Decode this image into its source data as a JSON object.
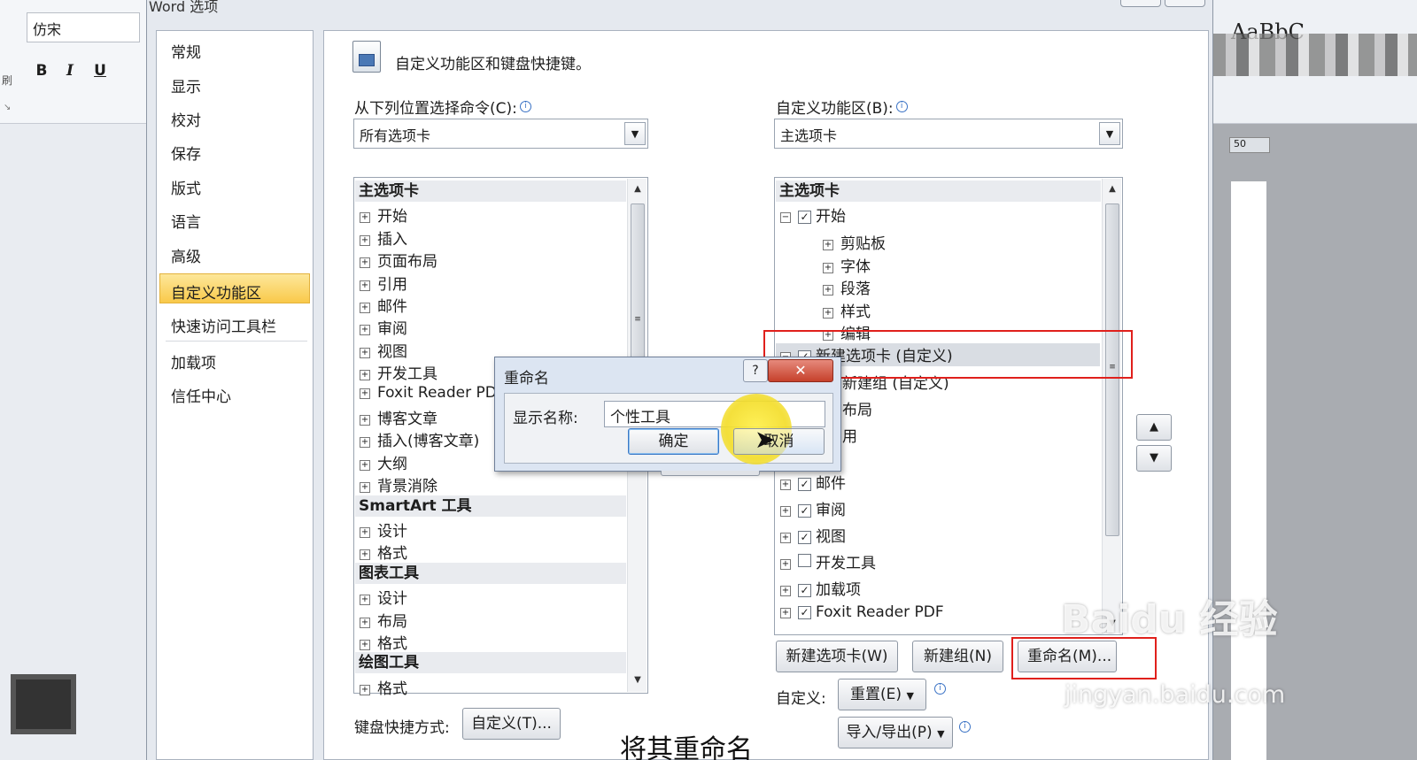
{
  "background": {
    "font_name": "仿宋",
    "format_buttons": [
      "B",
      "I",
      "U"
    ],
    "ruler_number": "50",
    "styles_preview": "AaBbC"
  },
  "dialog": {
    "title": "Word 选项",
    "nav": [
      "常规",
      "显示",
      "校对",
      "保存",
      "版式",
      "语言",
      "高级",
      "自定义功能区",
      "快速访问工具栏",
      "加载项",
      "信任中心"
    ],
    "selected_nav": "自定义功能区",
    "header_text": "自定义功能区和键盘快捷键。",
    "left": {
      "label": "从下列位置选择命令(C):",
      "combo_value": "所有选项卡",
      "items": [
        {
          "type": "group",
          "text": "主选项卡"
        },
        {
          "type": "item",
          "text": "开始"
        },
        {
          "type": "item",
          "text": "插入"
        },
        {
          "type": "item",
          "text": "页面布局"
        },
        {
          "type": "item",
          "text": "引用"
        },
        {
          "type": "item",
          "text": "邮件"
        },
        {
          "type": "item",
          "text": "审阅"
        },
        {
          "type": "item",
          "text": "视图"
        },
        {
          "type": "item",
          "text": "开发工具"
        },
        {
          "type": "item",
          "text": "Foxit Reader PD"
        },
        {
          "type": "item",
          "text": "博客文章"
        },
        {
          "type": "item",
          "text": "插入(博客文章)"
        },
        {
          "type": "item",
          "text": "大纲"
        },
        {
          "type": "item",
          "text": "背景消除"
        },
        {
          "type": "group",
          "text": "SmartArt 工具"
        },
        {
          "type": "item",
          "text": "设计"
        },
        {
          "type": "item",
          "text": "格式"
        },
        {
          "type": "group",
          "text": "图表工具"
        },
        {
          "type": "item",
          "text": "设计"
        },
        {
          "type": "item",
          "text": "布局"
        },
        {
          "type": "item",
          "text": "格式"
        },
        {
          "type": "group",
          "text": "绘图工具"
        },
        {
          "type": "item",
          "text": "格式"
        }
      ]
    },
    "right": {
      "label": "自定义功能区(B):",
      "combo_value": "主选项卡",
      "items": [
        {
          "type": "group",
          "text": "主选项卡"
        },
        {
          "type": "tab",
          "text": "开始",
          "checked": true,
          "expanded": true
        },
        {
          "type": "sub",
          "text": "剪贴板"
        },
        {
          "type": "sub",
          "text": "字体"
        },
        {
          "type": "sub",
          "text": "段落"
        },
        {
          "type": "sub",
          "text": "样式"
        },
        {
          "type": "sub",
          "text": "编辑"
        },
        {
          "type": "tab",
          "text": "新建选项卡 (自定义)",
          "checked": true,
          "expanded": true,
          "selected": true
        },
        {
          "type": "sub2",
          "text": "新建组 (自定义)"
        },
        {
          "type": "partial",
          "text": "布局"
        },
        {
          "type": "partial",
          "text": "用"
        },
        {
          "type": "tab",
          "text": "邮件",
          "checked": true
        },
        {
          "type": "tab",
          "text": "审阅",
          "checked": true
        },
        {
          "type": "tab",
          "text": "视图",
          "checked": true
        },
        {
          "type": "tab",
          "text": "开发工具",
          "checked": false
        },
        {
          "type": "tab",
          "text": "加载项",
          "checked": true
        },
        {
          "type": "tab",
          "text": "Foxit Reader PDF",
          "checked": true
        }
      ]
    },
    "buttons": {
      "new_tab": "新建选项卡(W)",
      "new_group": "新建组(N)",
      "rename": "重命名(M)...",
      "customize_label": "自定义:",
      "reset": "重置(E)",
      "import_export": "导入/导出(P)",
      "keyboard_label": "键盘快捷方式:",
      "keyboard_customize": "自定义(T)..."
    }
  },
  "rename_dialog": {
    "title": "重命名",
    "help": "?",
    "close": "✕",
    "name_label": "显示名称:",
    "name_value": "个性工具",
    "ok": "确定",
    "cancel": "取消"
  },
  "overlay": {
    "watermark": "Baidu 经验",
    "watermark_url": "jingyan.baidu.com",
    "subtitle": "将其重命名"
  },
  "colors": {
    "highlight_box": "#e0201c",
    "nav_selected": "#f9c94a",
    "cursor_highlight": "#f3dd2a"
  }
}
